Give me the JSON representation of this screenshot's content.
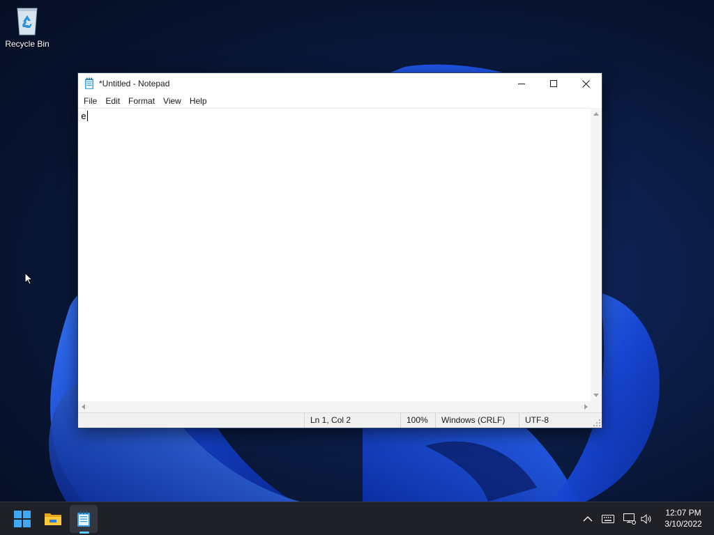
{
  "desktop": {
    "icons": [
      {
        "label": "Recycle Bin",
        "icon": "recycle-bin-icon"
      }
    ]
  },
  "window": {
    "title": "*Untitled - Notepad",
    "menu": [
      "File",
      "Edit",
      "Format",
      "View",
      "Help"
    ],
    "content": "e",
    "status": {
      "position": "Ln 1, Col 2",
      "zoom": "100%",
      "line_ending": "Windows (CRLF)",
      "encoding": "UTF-8"
    }
  },
  "taskbar": {
    "apps": [
      {
        "name": "Start",
        "icon": "windows-start-icon"
      },
      {
        "name": "File Explorer",
        "icon": "folder-icon"
      },
      {
        "name": "Notepad",
        "icon": "notepad-icon",
        "active": true
      }
    ],
    "tray": {
      "icons": [
        "chevron-up-icon",
        "keyboard-icon",
        "network-icon",
        "volume-icon"
      ],
      "time": "12:07 PM",
      "date": "3/10/2022"
    }
  },
  "colors": {
    "accent": "#60cdff",
    "taskbar": "#1f2126",
    "wallpaper_dark": "#081431",
    "wallpaper_bloom": "#1e5ef0"
  }
}
